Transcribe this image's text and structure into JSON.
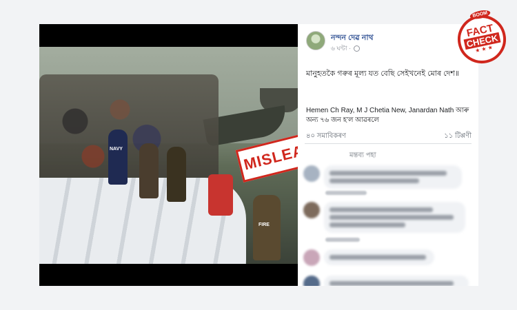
{
  "post": {
    "author": "নন্দন দেৱ নাথ",
    "time": "৬ ঘন্টা ·",
    "text": "মানুহতকৈ গৰুৰ মূল্য যত বেছি সেইখনেই মোৰ দেশ॥",
    "tagged": "Hemen Ch Ray, M J Chetia New, Janardan Nath আৰু অন্য ৭৬ জন হ'ল আৱৰলে",
    "reactions": "৪০ সমাবিকৰণ",
    "comments_count": "১১ টিপ্পণী",
    "comment_header": "মন্তব্য পহা"
  },
  "photo": {
    "jacket_text": "NAVY",
    "vest_text": "FIRE"
  },
  "overlay": {
    "label": "MISLEADING",
    "accent": "#d0271d"
  },
  "stamp": {
    "top": "BOOM",
    "line1": "FACT",
    "line2": "CHECK",
    "stars": "★ ★ ★"
  },
  "icons": {
    "privacy": "globe-icon"
  }
}
